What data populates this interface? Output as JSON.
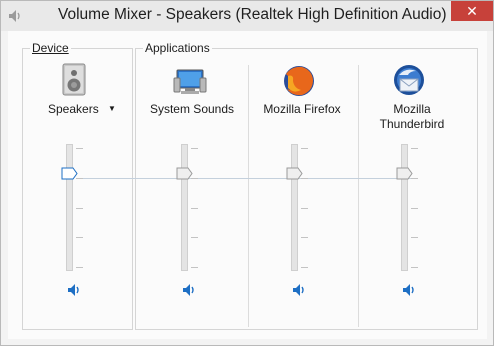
{
  "window": {
    "title": "Volume Mixer - Speakers (Realtek High Definition Audio)",
    "close_glyph": "✕"
  },
  "device": {
    "group_label": "Device",
    "name": "Speakers",
    "dropdown_glyph": "▼",
    "icon": "speaker-device-icon",
    "volume": 0.8,
    "muted": false
  },
  "applications": {
    "group_label": "Applications",
    "items": [
      {
        "name": "System Sounds",
        "icon": "system-sounds-icon",
        "volume": 0.8,
        "muted": false
      },
      {
        "name": "Mozilla Firefox",
        "icon": "firefox-icon",
        "volume": 0.8,
        "muted": false
      },
      {
        "name": "Mozilla\nThunderbird",
        "icon": "thunderbird-icon",
        "volume": 0.8,
        "muted": false
      }
    ]
  },
  "colors": {
    "thumb_active": "#1e6fc4",
    "mute_icon": "#1e6fc4",
    "close_button": "#c7413a"
  }
}
